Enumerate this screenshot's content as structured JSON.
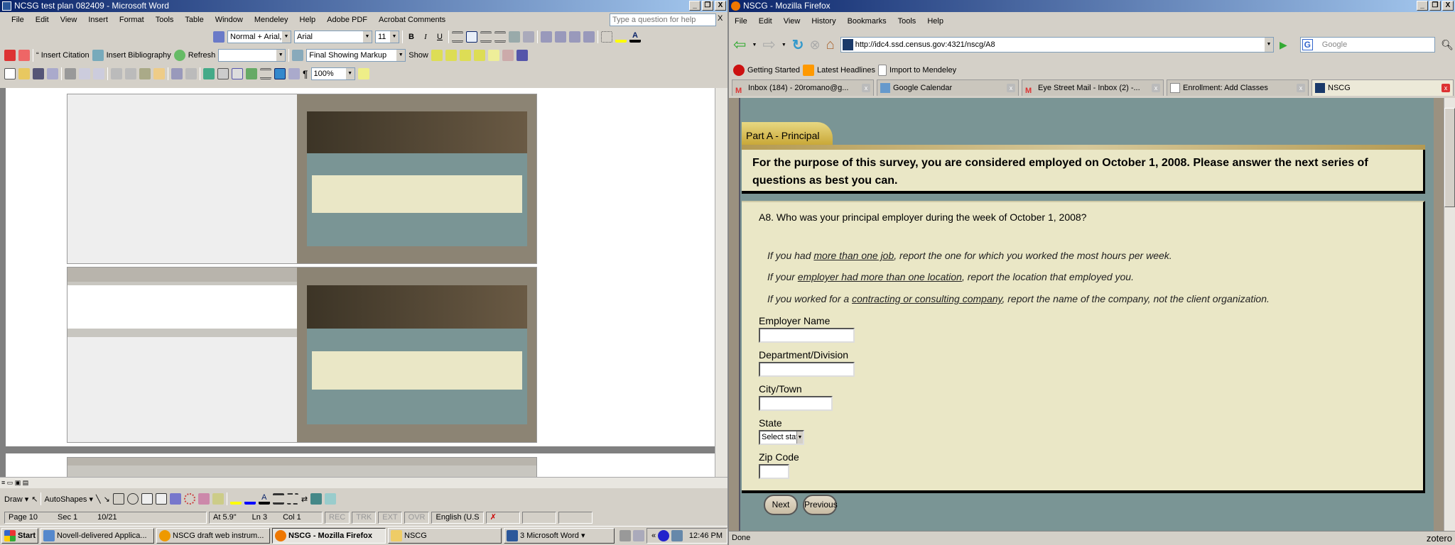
{
  "word": {
    "title": "NCSG test plan 082409 - Microsoft Word",
    "menu": [
      "File",
      "Edit",
      "View",
      "Insert",
      "Format",
      "Tools",
      "Table",
      "Window",
      "Mendeley",
      "Help",
      "Adobe PDF",
      "Acrobat Comments"
    ],
    "help_placeholder": "Type a question for help",
    "style_value": "Normal + Arial,",
    "font_value": "Arial",
    "size_value": "11",
    "bold": "B",
    "italic": "I",
    "underline": "U",
    "insert_citation": "Insert Citation",
    "insert_bibliography": "Insert Bibliography",
    "refresh": "Refresh",
    "markup_value": "Final Showing Markup",
    "show": "Show",
    "zoom_value": "100%",
    "pilcrow": "¶",
    "draw": "Draw",
    "autoshapes": "AutoShapes",
    "status": {
      "page": "Page 10",
      "sec": "Sec 1",
      "pages": "10/21",
      "at": "At 5.9\"",
      "ln": "Ln 3",
      "col": "Col 1",
      "rec": "REC",
      "trk": "TRK",
      "ext": "EXT",
      "ovr": "OVR",
      "lang": "English (U.S"
    }
  },
  "taskbar": {
    "start": "Start",
    "items": [
      "Novell-delivered Applica...",
      "NSCG draft web instrum...",
      "NSCG - Mozilla Firefox",
      "NSCG",
      "3 Microsoft Word"
    ],
    "active_index": 2,
    "clock": "12:46 PM"
  },
  "firefox": {
    "title": "NSCG - Mozilla Firefox",
    "menu": [
      "File",
      "Edit",
      "View",
      "History",
      "Bookmarks",
      "Tools",
      "Help"
    ],
    "url": "http://idc4.ssd.census.gov:4321/nscg/A8",
    "search_placeholder": "Google",
    "bookmarks": [
      "Getting Started",
      "Latest Headlines",
      "Import to Mendeley"
    ],
    "tabs": [
      "Inbox (184) - 20romano@g...",
      "Google Calendar",
      "Eye Street Mail - Inbox (2) -...",
      "Enrollment: Add Classes",
      "NSCG"
    ],
    "active_tab": 4,
    "status": "Done",
    "zotero": "zotero"
  },
  "survey": {
    "section_tab": "Part A - Principal Employer",
    "intro": "For the purpose of this survey, you are considered employed on October 1, 2008. Please answer the next series of questions as best you can.",
    "question": "A8. Who was your principal employer during the week of October 1, 2008?",
    "notes": [
      {
        "pre": "If you had ",
        "link": "more than one job",
        "post": ", report the one for which you worked the most hours per week."
      },
      {
        "pre": "If your ",
        "link": "employer had more than one location",
        "post": ", report the location that employed you."
      },
      {
        "pre": "If you worked for a ",
        "link": "contracting or consulting company",
        "post": ", report the name of the company, not the client organization."
      }
    ],
    "fields": {
      "employer_name": {
        "label": "Employer Name",
        "value": ""
      },
      "department": {
        "label": "Department/Division",
        "value": ""
      },
      "city": {
        "label": "City/Town",
        "value": ""
      },
      "state": {
        "label": "State",
        "value": "Select state"
      },
      "zip": {
        "label": "Zip Code",
        "value": ""
      }
    },
    "next": "Next",
    "previous": "Previous"
  },
  "colors": {
    "teal": "#7a9595",
    "cream": "#eae7c6",
    "gold": "#c9a838",
    "outer": "#9b9180"
  }
}
